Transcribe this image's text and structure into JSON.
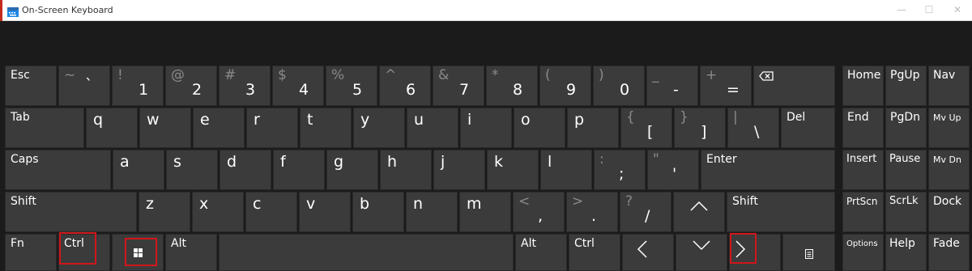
{
  "window": {
    "title": "On-Screen Keyboard",
    "minimize_glyph": "—",
    "maximize_glyph": "☐",
    "close_glyph": "✕"
  },
  "rows": {
    "r1": {
      "esc": "Esc",
      "k1": {
        "top": "~",
        "main": "`"
      },
      "k2": {
        "top": "!",
        "main": "1"
      },
      "k3": {
        "top": "@",
        "main": "2"
      },
      "k4": {
        "top": "#",
        "main": "3"
      },
      "k5": {
        "top": "$",
        "main": "4"
      },
      "k6": {
        "top": "%",
        "main": "5"
      },
      "k7": {
        "top": "^",
        "main": "6"
      },
      "k8": {
        "top": "&",
        "main": "7"
      },
      "k9": {
        "top": "*",
        "main": "8"
      },
      "k10": {
        "top": "(",
        "main": "9"
      },
      "k11": {
        "top": ")",
        "main": "0"
      },
      "k12": {
        "top": "_",
        "main": "-"
      },
      "k13": {
        "top": "+",
        "main": "="
      },
      "backspace_icon": "backspace-icon"
    },
    "r2": {
      "tab": "Tab",
      "letters": [
        "q",
        "w",
        "e",
        "r",
        "t",
        "y",
        "u",
        "i",
        "o",
        "p"
      ],
      "lbracket": {
        "top": "{",
        "main": "["
      },
      "rbracket": {
        "top": "}",
        "main": "]"
      },
      "backslash": {
        "top": "|",
        "main": "\\"
      },
      "del": "Del"
    },
    "r3": {
      "caps": "Caps",
      "letters": [
        "a",
        "s",
        "d",
        "f",
        "g",
        "h",
        "j",
        "k",
        "l"
      ],
      "semicolon": {
        "top": ":",
        "main": ";"
      },
      "quote": {
        "top": "\"",
        "main": "'"
      },
      "enter": "Enter"
    },
    "r4": {
      "shift_left": "Shift",
      "letters": [
        "z",
        "x",
        "c",
        "v",
        "b",
        "n",
        "m"
      ],
      "comma": {
        "top": "<",
        "main": ","
      },
      "period": {
        "top": ">",
        "main": "."
      },
      "slash": {
        "top": "?",
        "main": "/"
      },
      "shift_right": "Shift"
    },
    "r5": {
      "fn": "Fn",
      "ctrl_left": "Ctrl",
      "alt_left": "Alt",
      "alt_right": "Alt",
      "ctrl_right": "Ctrl"
    }
  },
  "nav_keys": {
    "home": "Home",
    "pgup": "PgUp",
    "nav": "Nav",
    "end": "End",
    "pgdn": "PgDn",
    "mvup": "Mv Up",
    "insert": "Insert",
    "pause": "Pause",
    "mvdn": "Mv Dn",
    "prtscn": "PrtScn",
    "scrlk": "ScrLk",
    "dock": "Dock",
    "options": "Options",
    "help": "Help",
    "fade": "Fade"
  },
  "highlight_color": "#d1161b",
  "key_color": "#3b3b3b",
  "background_color": "#1b1b1b"
}
